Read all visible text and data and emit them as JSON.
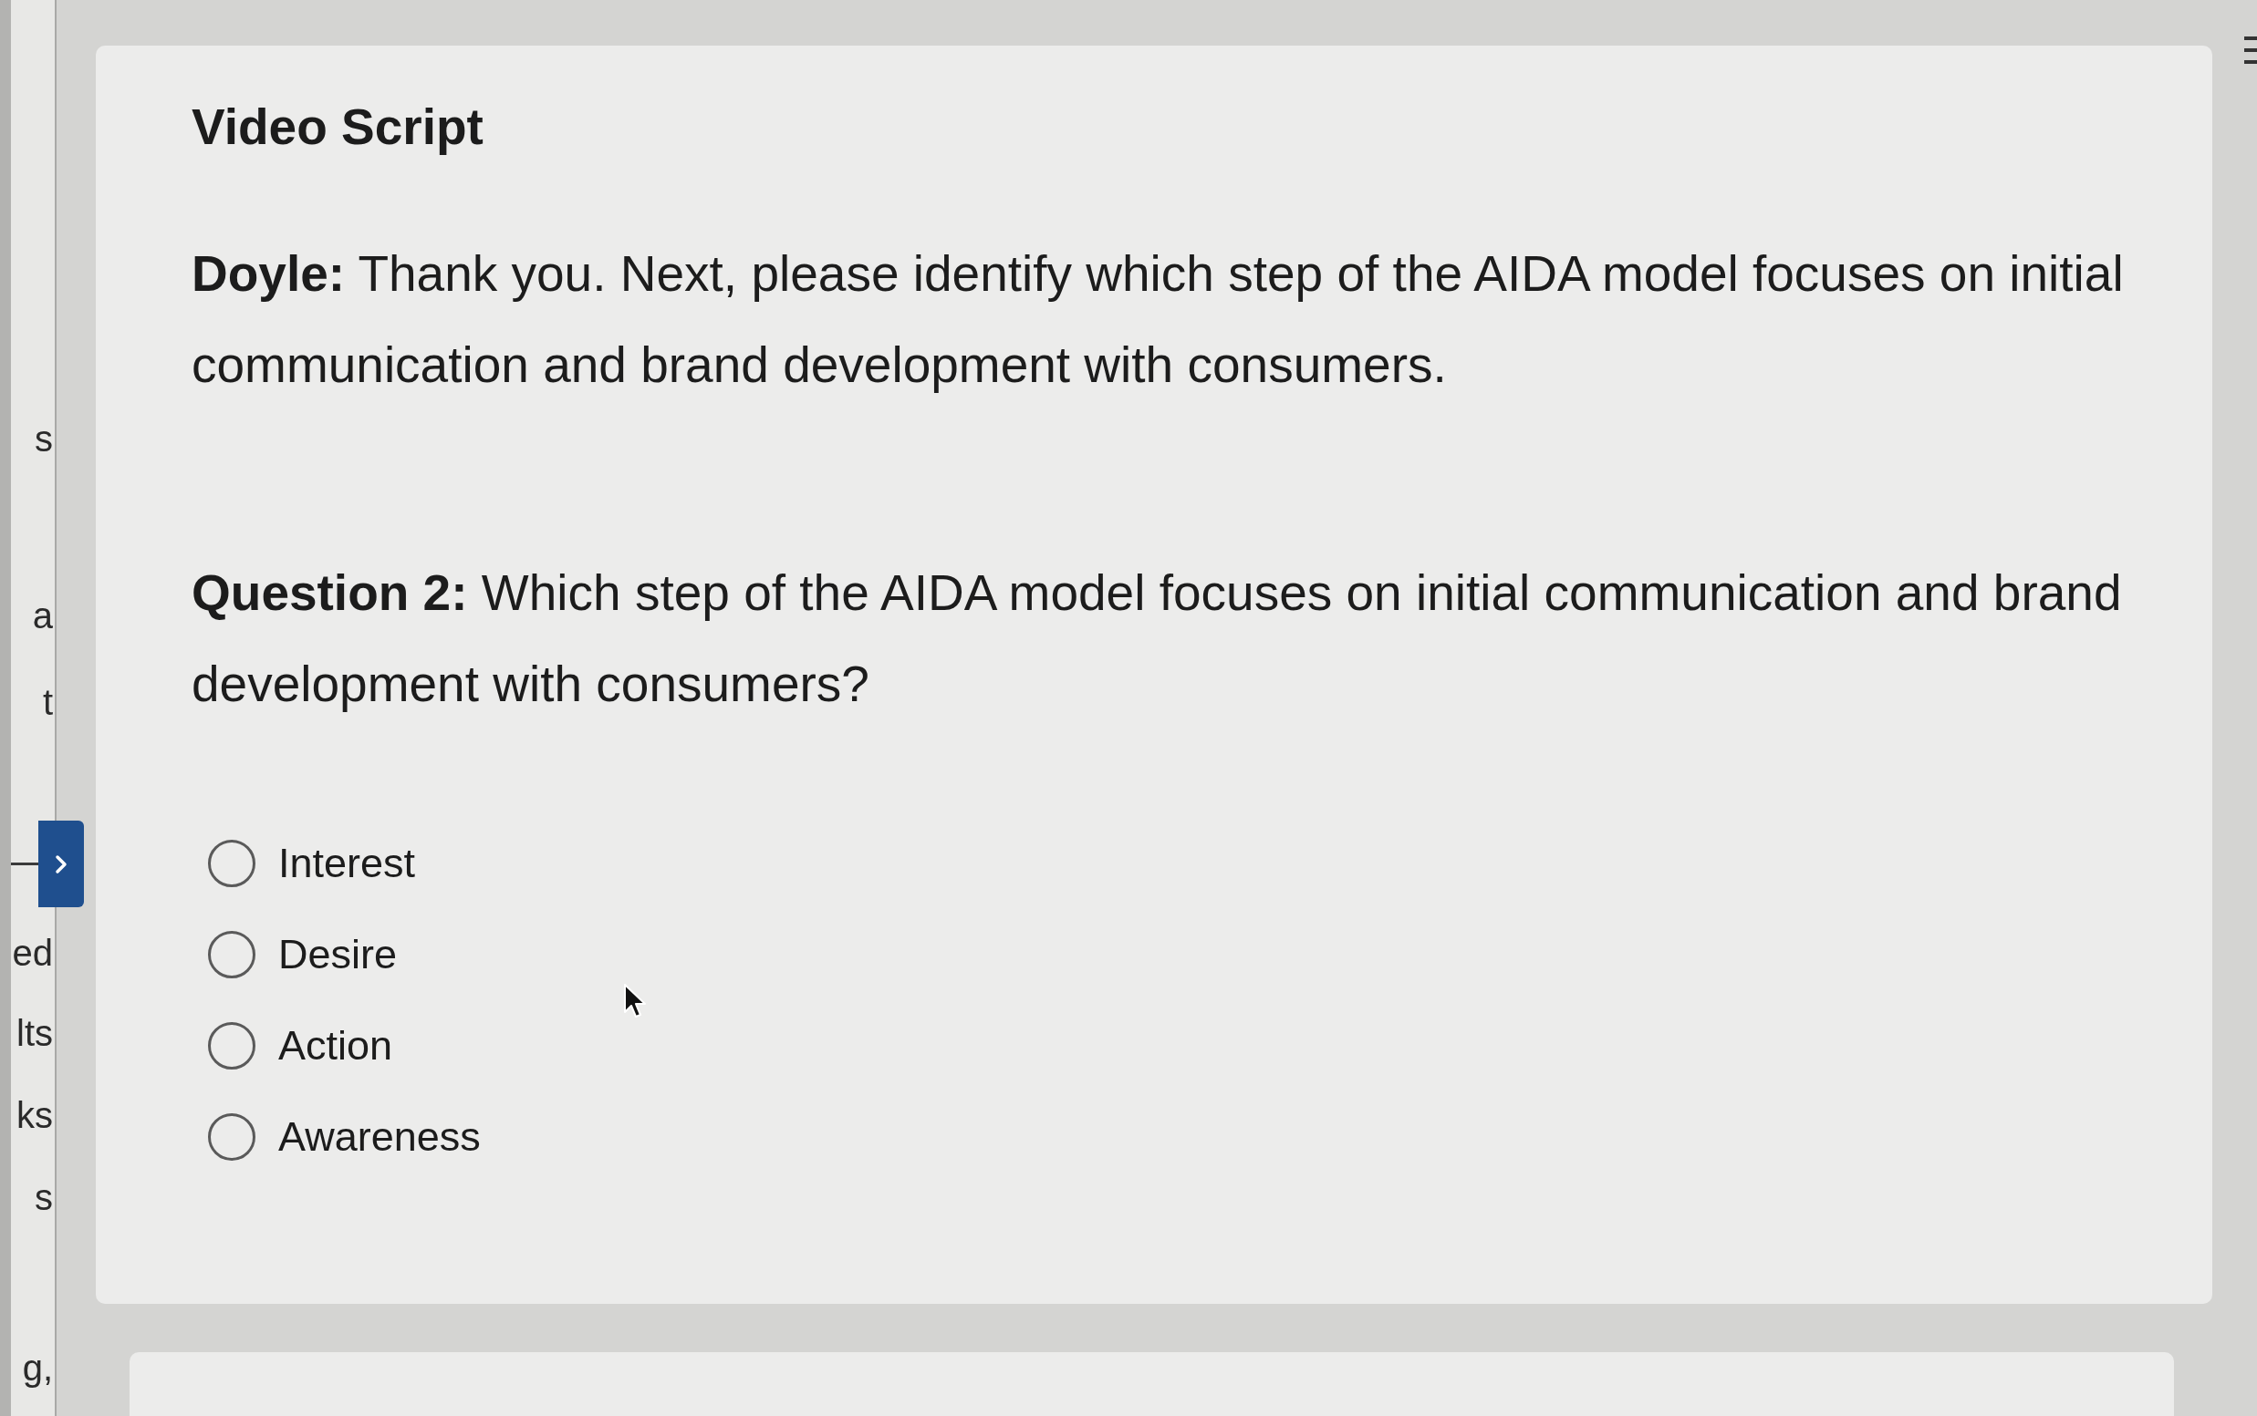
{
  "sidebar": {
    "items": [
      {
        "label": "s"
      },
      {
        "label": "a"
      },
      {
        "label": "t"
      },
      {
        "label": "ed"
      },
      {
        "label": "lts"
      },
      {
        "label": "ks"
      },
      {
        "label": "s"
      },
      {
        "label": "g,"
      }
    ]
  },
  "card": {
    "title": "Video Script",
    "script": "**Doyle:** Thank you. Next, please identify which step of the AIDA model focuses on initial communication and brand development with consumers.",
    "question": "**Question 2:** Which step of the AIDA model focuses on initial communication and brand development with consumers?",
    "options": [
      {
        "label": "Interest",
        "selected": false
      },
      {
        "label": "Desire",
        "selected": false
      },
      {
        "label": "Action",
        "selected": false
      },
      {
        "label": "Awareness",
        "selected": false
      }
    ]
  }
}
